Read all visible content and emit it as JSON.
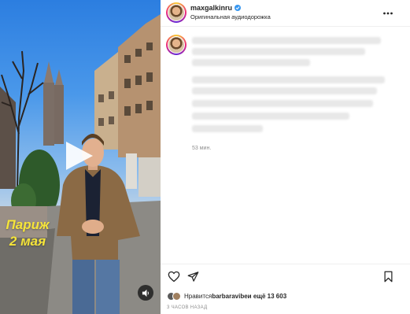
{
  "video": {
    "caption_line1": "Париж",
    "caption_line2": "2 мая",
    "play_icon": "play-icon",
    "audio_icon": "speaker-icon"
  },
  "post": {
    "username": "maxgalkinru",
    "verified": true,
    "audio_label": "Оригинальная аудиодорожка",
    "more_icon": "ellipsis-icon"
  },
  "comment": {
    "time_ago": "53 мин."
  },
  "actions": {
    "like_icon": "heart-icon",
    "share_icon": "send-icon",
    "save_icon": "bookmark-icon"
  },
  "likes": {
    "prefix": "Нравится ",
    "user": "barbaravibe",
    "suffix": " и ещё 13 603"
  },
  "posted_ago": "3 ЧАСОВ НАЗАД",
  "colors": {
    "caption": "#f6e53a",
    "verified": "#3897f0",
    "muted_text": "#8e8e8e"
  }
}
